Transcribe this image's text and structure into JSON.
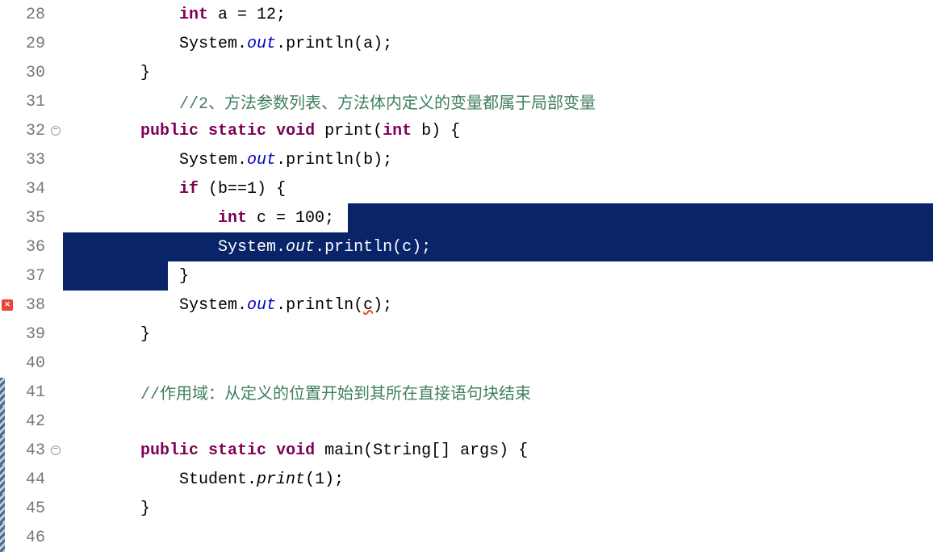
{
  "lines": [
    {
      "num": "28",
      "marker": "",
      "fold": "",
      "change": "",
      "indent": "            ",
      "tokens": [
        {
          "t": "int",
          "c": "kw"
        },
        {
          "t": " a = 12;",
          "c": ""
        }
      ]
    },
    {
      "num": "29",
      "marker": "",
      "fold": "",
      "change": "",
      "indent": "            ",
      "tokens": [
        {
          "t": "System.",
          "c": ""
        },
        {
          "t": "out",
          "c": "italic-static"
        },
        {
          "t": ".println(a);",
          "c": ""
        }
      ]
    },
    {
      "num": "30",
      "marker": "",
      "fold": "",
      "change": "",
      "indent": "        ",
      "tokens": [
        {
          "t": "}",
          "c": ""
        }
      ]
    },
    {
      "num": "31",
      "marker": "",
      "fold": "",
      "change": "",
      "indent": "            ",
      "tokens": [
        {
          "t": "//2、方法参数列表、方法体内定义的变量都属于局部变量",
          "c": "comment"
        }
      ]
    },
    {
      "num": "32",
      "marker": "",
      "fold": "minus",
      "change": "",
      "indent": "        ",
      "tokens": [
        {
          "t": "public",
          "c": "kw"
        },
        {
          "t": " ",
          "c": ""
        },
        {
          "t": "static",
          "c": "kw"
        },
        {
          "t": " ",
          "c": ""
        },
        {
          "t": "void",
          "c": "kw"
        },
        {
          "t": " print(",
          "c": ""
        },
        {
          "t": "int",
          "c": "kw"
        },
        {
          "t": " b) {",
          "c": ""
        }
      ]
    },
    {
      "num": "33",
      "marker": "",
      "fold": "",
      "change": "",
      "indent": "            ",
      "tokens": [
        {
          "t": "System.",
          "c": ""
        },
        {
          "t": "out",
          "c": "italic-static"
        },
        {
          "t": ".println(b);",
          "c": ""
        }
      ]
    },
    {
      "num": "34",
      "marker": "",
      "fold": "",
      "change": "",
      "indent": "            ",
      "tokens": [
        {
          "t": "if",
          "c": "kw"
        },
        {
          "t": " (b==1) {",
          "c": ""
        }
      ]
    },
    {
      "num": "35",
      "marker": "",
      "fold": "",
      "change": "",
      "indent": "                ",
      "sel_start": 353,
      "sel_end": 9999,
      "tokens": [
        {
          "t": "int",
          "c": "kw"
        },
        {
          "t": " c = 100;",
          "c": ""
        }
      ]
    },
    {
      "num": "36",
      "marker": "",
      "fold": "",
      "change": "",
      "indent": "                ",
      "sel_start": 0,
      "sel_end": 9999,
      "tokens": [
        {
          "t": "System.",
          "c": ""
        },
        {
          "t": "out",
          "c": "italic-static"
        },
        {
          "t": ".println(c);",
          "c": ""
        }
      ],
      "selected": true
    },
    {
      "num": "37",
      "marker": "",
      "fold": "",
      "change": "",
      "indent": "            ",
      "sel_start": 0,
      "sel_end": 130,
      "tokens": [
        {
          "t": "}",
          "c": ""
        }
      ],
      "cursor": true
    },
    {
      "num": "38",
      "marker": "error",
      "fold": "",
      "change": "",
      "indent": "            ",
      "tokens": [
        {
          "t": "System.",
          "c": ""
        },
        {
          "t": "out",
          "c": "italic-static"
        },
        {
          "t": ".println(",
          "c": ""
        },
        {
          "t": "c",
          "c": "error-underline"
        },
        {
          "t": ");",
          "c": ""
        }
      ]
    },
    {
      "num": "39",
      "marker": "",
      "fold": "",
      "change": "",
      "indent": "        ",
      "tokens": [
        {
          "t": "}",
          "c": ""
        }
      ]
    },
    {
      "num": "40",
      "marker": "",
      "fold": "",
      "change": "",
      "indent": "        ",
      "tokens": []
    },
    {
      "num": "41",
      "marker": "",
      "fold": "",
      "change": "hatched",
      "indent": "        ",
      "tokens": [
        {
          "t": "//作用域：从定义的位置开始到其所在直接语句块结束",
          "c": "comment"
        }
      ]
    },
    {
      "num": "42",
      "marker": "",
      "fold": "",
      "change": "hatched",
      "indent": "        ",
      "tokens": []
    },
    {
      "num": "43",
      "marker": "",
      "fold": "minus",
      "change": "hatched",
      "indent": "        ",
      "tokens": [
        {
          "t": "public",
          "c": "kw"
        },
        {
          "t": " ",
          "c": ""
        },
        {
          "t": "static",
          "c": "kw"
        },
        {
          "t": " ",
          "c": ""
        },
        {
          "t": "void",
          "c": "kw"
        },
        {
          "t": " main(String[] args) {",
          "c": ""
        }
      ]
    },
    {
      "num": "44",
      "marker": "",
      "fold": "",
      "change": "hatched",
      "indent": "            ",
      "tokens": [
        {
          "t": "Student.",
          "c": ""
        },
        {
          "t": "print",
          "c": "italic-method"
        },
        {
          "t": "(1);",
          "c": ""
        }
      ]
    },
    {
      "num": "45",
      "marker": "",
      "fold": "",
      "change": "hatched",
      "indent": "        ",
      "tokens": [
        {
          "t": "}",
          "c": ""
        }
      ]
    },
    {
      "num": "46",
      "marker": "",
      "fold": "",
      "change": "hatched",
      "indent": "",
      "tokens": []
    }
  ],
  "cursor_glyph": "⎮"
}
